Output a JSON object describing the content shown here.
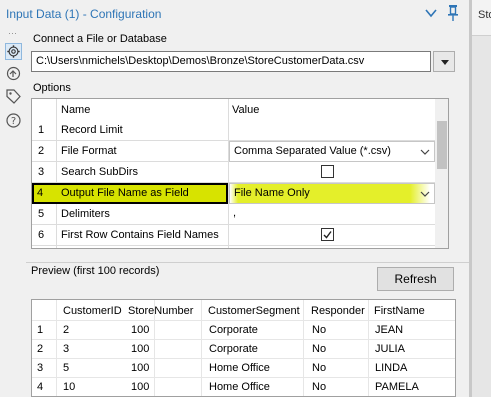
{
  "window": {
    "title": "Input Data (1) - Configuration",
    "right_pane_text": "Sto"
  },
  "connect": {
    "label": "Connect a File or Database",
    "path": "C:\\Users\\nmichels\\Desktop\\Demos\\Bronze\\StoreCustomerData.csv"
  },
  "options": {
    "label": "Options",
    "headers": {
      "name": "Name",
      "value": "Value"
    },
    "rows": [
      {
        "num": "1",
        "name": "Record Limit",
        "value": ""
      },
      {
        "num": "2",
        "name": "File Format",
        "value": "Comma Separated Value (*.csv)"
      },
      {
        "num": "3",
        "name": "Search SubDirs",
        "value": ""
      },
      {
        "num": "4",
        "name": "Output File Name as Field",
        "value": "File Name Only"
      },
      {
        "num": "5",
        "name": "Delimiters",
        "value": ","
      },
      {
        "num": "6",
        "name": "First Row Contains Field Names",
        "value": ""
      }
    ]
  },
  "preview": {
    "label": "Preview (first 100 records)",
    "refresh_label": "Refresh",
    "columns": [
      "CustomerID",
      "StoreNumber",
      "CustomerSegment",
      "Responder",
      "FirstName"
    ],
    "rows": [
      {
        "num": "1",
        "cells": [
          "2",
          "100",
          "Corporate",
          "No",
          "JEAN"
        ]
      },
      {
        "num": "2",
        "cells": [
          "3",
          "100",
          "Corporate",
          "No",
          "JULIA"
        ]
      },
      {
        "num": "3",
        "cells": [
          "5",
          "100",
          "Home Office",
          "No",
          "LINDA"
        ]
      },
      {
        "num": "4",
        "cells": [
          "10",
          "100",
          "Home Office",
          "No",
          "PAMELA"
        ]
      }
    ]
  },
  "colors": {
    "title": "#2e75b6",
    "highlight": "#d7e300"
  }
}
